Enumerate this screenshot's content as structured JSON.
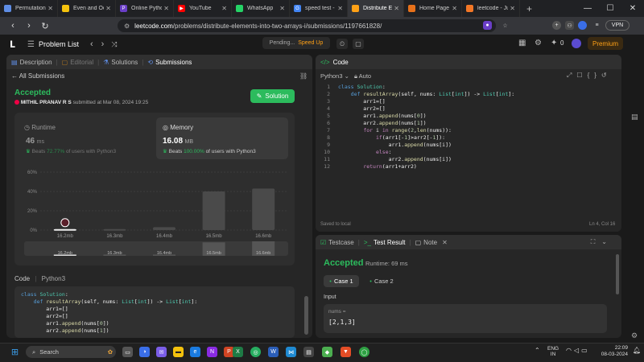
{
  "browser": {
    "tabs": [
      {
        "label": "Permutation and",
        "color": "#5f8ee6"
      },
      {
        "label": "Even and Odd Fu",
        "color": "#f4c20d"
      },
      {
        "label": "Online Python Co",
        "color": "#6a3ec7",
        "fav": "P"
      },
      {
        "label": "YouTube",
        "color": "#ff0000",
        "fav": "▶"
      },
      {
        "label": "WhatsApp",
        "color": "#25d366"
      },
      {
        "label": "speed test - Goog",
        "color": "#4285f4",
        "fav": "G"
      },
      {
        "label": "Distribute Ele",
        "color": "#ffa116",
        "active": true
      },
      {
        "label": "Home Page - Sele",
        "color": "#e8711a"
      },
      {
        "label": "leetcode - Jupyte",
        "color": "#f37726"
      }
    ],
    "url_prefix": "leetcode.com",
    "url_path": "/problems/distribute-elements-into-two-arrays-i/submissions/1197661828/",
    "vpn_label": "VPN"
  },
  "header": {
    "problem_list": "Problem List",
    "pending": "Pending...",
    "speed_up": "Speed Up",
    "streak": "0",
    "premium": "Premium"
  },
  "left_tabs": {
    "description": "Description",
    "editorial": "Editorial",
    "solutions": "Solutions",
    "submissions": "Submissions"
  },
  "submission": {
    "all_submissions": "All Submissions",
    "status": "Accepted",
    "user": "MITHIL PRANAV R S",
    "submitted_at": "submitted at Mar 08, 2024 19:25",
    "solution_button": "Solution",
    "runtime_label": "Runtime",
    "runtime_value": "46",
    "runtime_unit": "ms",
    "runtime_beats_prefix": "Beats",
    "runtime_beats_pct": "72.77%",
    "runtime_beats_suffix": "of users with Python3",
    "memory_label": "Memory",
    "memory_value": "16.08",
    "memory_unit": "MB",
    "memory_beats_prefix": "Beats",
    "memory_beats_pct": "100.00%",
    "memory_beats_suffix": "of users with Python3"
  },
  "chart_data": {
    "type": "bar",
    "categories": [
      "16.2mb",
      "16.3mb",
      "16.4mb",
      "16.5mb",
      "16.6mb"
    ],
    "values": [
      1,
      1,
      3,
      40,
      43
    ],
    "ylim": [
      0,
      60
    ],
    "yticks": [
      "0%",
      "20%",
      "40%",
      "60%"
    ],
    "grid": true,
    "highlight_index": 0,
    "overview_values": [
      1,
      1,
      3,
      40,
      43
    ]
  },
  "code_section": {
    "label": "Code",
    "language": "Python3",
    "lines": [
      "class Solution:",
      "    def resultArray(self, nums: List[int]) -> List[int]:",
      "        arr1=[]",
      "        arr2=[]",
      "        arr1.append(nums[0])",
      "        arr2.append(nums[1])"
    ]
  },
  "editor": {
    "title": "Code",
    "language": "Python3",
    "auto": "Auto",
    "lines": [
      "class Solution:",
      "    def resultArray(self, nums: List[int]) -> List[int]:",
      "        arr1=[]",
      "        arr2=[]",
      "        arr1.append(nums[0])",
      "        arr2.append(nums[1])",
      "        for i in range(2,len(nums)):",
      "            if(arr1[-1]>arr2[-1]):",
      "                arr1.append(nums[i])",
      "            else:",
      "                arr2.append(nums[i])",
      "        return(arr1+arr2)"
    ],
    "saved": "Saved to local",
    "position": "Ln 4, Col 16"
  },
  "result": {
    "testcase_tab": "Testcase",
    "result_tab": "Test Result",
    "note_tab": "Note",
    "status": "Accepted",
    "runtime": "Runtime: 69 ms",
    "case1": "Case 1",
    "case2": "Case 2",
    "input_label": "Input",
    "var_label": "nums =",
    "var_value": "[2,1,3]"
  },
  "taskbar": {
    "search": "Search",
    "lang1": "ENG",
    "lang2": "IN",
    "time": "22:09",
    "date": "08-03-2024"
  },
  "colors": {
    "accent_green": "#2cbb5d",
    "accent_orange": "#ffa116",
    "panel": "#262626"
  }
}
